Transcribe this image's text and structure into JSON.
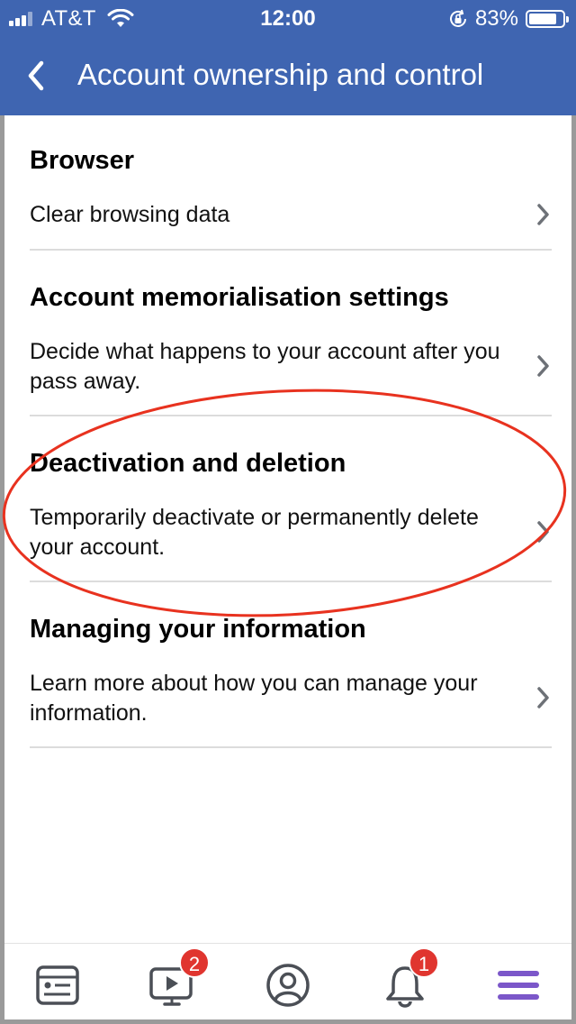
{
  "status_bar": {
    "carrier": "AT&T",
    "time": "12:00",
    "battery_percent": "83%",
    "battery_level": 0.83
  },
  "nav": {
    "title": "Account ownership and control",
    "back_icon": "chevron-left-icon"
  },
  "sections": [
    {
      "title": "Browser",
      "row_text": "Clear browsing data"
    },
    {
      "title": "Account memorialisation settings",
      "row_text": "Decide what happens to your account after you pass away."
    },
    {
      "title": "Deactivation and deletion",
      "row_text": "Temporarily deactivate or permanently delete your account."
    },
    {
      "title": "Managing your information",
      "row_text": "Learn more about how you can manage your information."
    }
  ],
  "annotation": {
    "color": "#e8321f"
  },
  "tab_bar": {
    "tabs": [
      {
        "icon": "news-feed-icon"
      },
      {
        "icon": "watch-icon",
        "badge": "2"
      },
      {
        "icon": "profile-icon"
      },
      {
        "icon": "notifications-bell-icon",
        "badge": "1"
      },
      {
        "icon": "menu-icon"
      }
    ]
  },
  "colors": {
    "header_bg": "#3f65b1",
    "tab_icon": "#4b4f56",
    "menu_active": "#7b57c9",
    "badge": "#e0352f"
  }
}
